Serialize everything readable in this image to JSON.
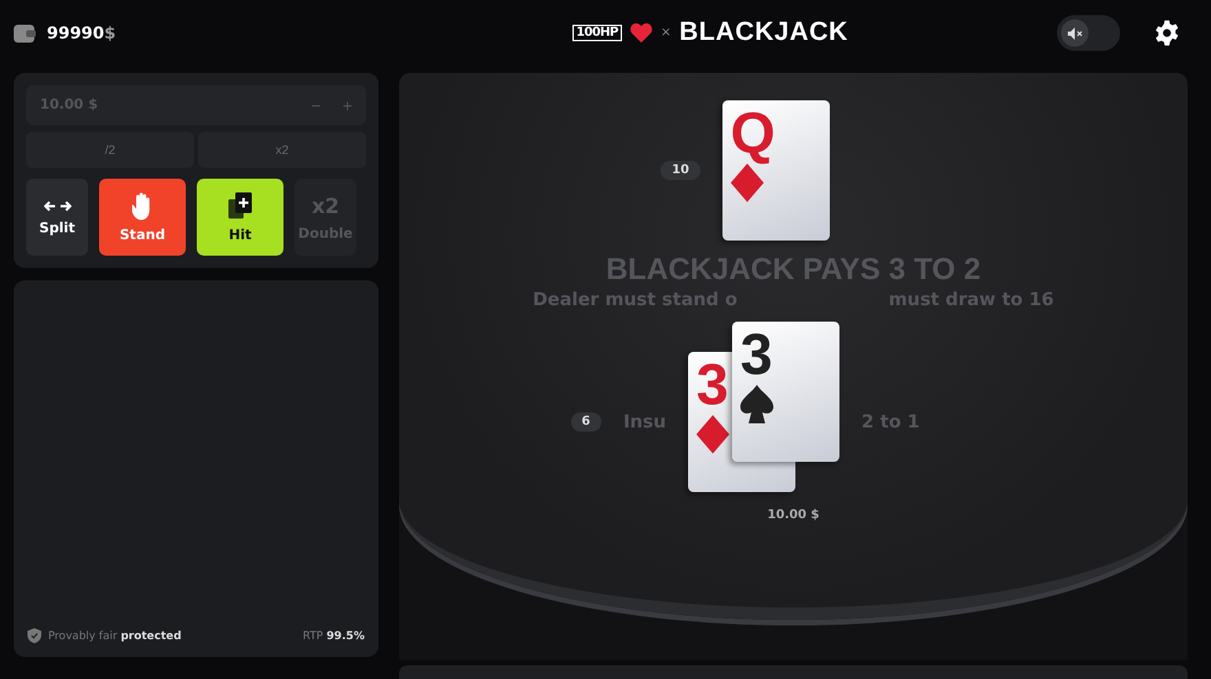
{
  "header": {
    "balance": "99990",
    "currency": "$",
    "logo_badge": "100HP",
    "logo_separator": "×",
    "title": "BLACKJACK",
    "sound_on": false
  },
  "bet": {
    "value": "10.00 $",
    "minus": "−",
    "plus": "+",
    "half": "/2",
    "double": "x2",
    "disabled": true
  },
  "actions": [
    {
      "kind": "split",
      "label": "Split",
      "disabled": false
    },
    {
      "kind": "stand",
      "label": "Stand",
      "disabled": false
    },
    {
      "kind": "hit",
      "label": "Hit",
      "disabled": false
    },
    {
      "kind": "double",
      "label": "Double",
      "symbol": "x2",
      "disabled": true
    }
  ],
  "footer": {
    "fair_label": "Provably fair",
    "fair_status": "protected",
    "rtp_label": "RTP",
    "rtp_value": "99.5%"
  },
  "table": {
    "dealer": {
      "score": "10",
      "cards": [
        {
          "rank": "Q",
          "kind": "diamond"
        }
      ]
    },
    "headline": "BLACKJACK PAYS 3 TO 2",
    "rule_left": "Dealer must stand o",
    "rule_right": "must draw to 16",
    "insurance_left": "Insu",
    "insurance_right": "2 to 1",
    "player": {
      "score": "6",
      "cards": [
        {
          "rank": "3",
          "kind": "diamond"
        },
        {
          "rank": "3",
          "kind": "spade"
        }
      ],
      "bet": "10.00 $"
    }
  }
}
